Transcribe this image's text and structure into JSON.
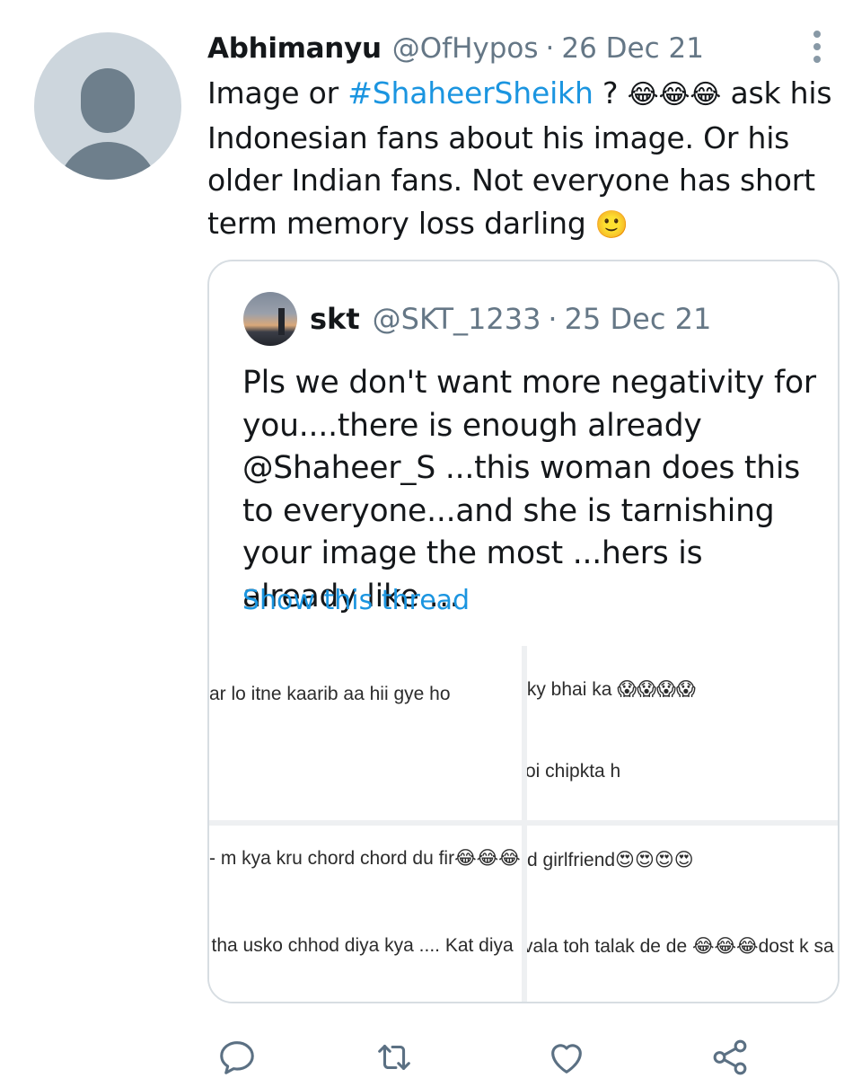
{
  "tweet": {
    "author_name": "Abhimanyu",
    "author_handle": "@OfHypos",
    "separator": "·",
    "date": "26 Dec 21",
    "text": {
      "part1": "Image or ",
      "hashtag": "#ShaheerSheikh",
      "part2": " ? ",
      "emoji_laugh": "😂😂😂",
      "part3": " ask his Indonesian fans about his image. Or his older Indian fans. Not everyone has short term memory loss darling ",
      "emoji_smile": "🙂"
    },
    "avatar_icon": "default-profile-silhouette",
    "more_icon": "more-vertical-icon"
  },
  "quoted_tweet": {
    "author_name": "skt",
    "author_handle": "@SKT_1233",
    "separator": "·",
    "date": "25 Dec 21",
    "text": "Pls we don't want more negativity for you....there is enough already @Shaheer_S ...this woman does this to everyone...and she is tarnishing your image the most ...hers is already like …",
    "show_thread_label": "Show this thread",
    "images": [
      {
        "lines": [
          "ar lo itne kaarib aa hii gye ho"
        ]
      },
      {
        "lines": [
          ":ky bhai ka 😱😱😱😱",
          "oi chipkta h"
        ]
      },
      {
        "lines": [
          "- m kya kru chord chord du fir😂😂😂",
          "l tha usko chhod diya kya .... Kat diya"
        ]
      },
      {
        "lines": [
          "d girlfriend😍😍😍😍",
          "vala toh talak de de 😂😂😂dost k sa"
        ]
      }
    ]
  },
  "actions": {
    "reply_icon": "reply-icon",
    "retweet_icon": "retweet-icon",
    "like_icon": "like-icon",
    "share_icon": "share-icon"
  },
  "colors": {
    "accent": "#1b95e0",
    "secondary_text": "#657786",
    "icon": "#5b7083",
    "border": "#d7dde2"
  }
}
